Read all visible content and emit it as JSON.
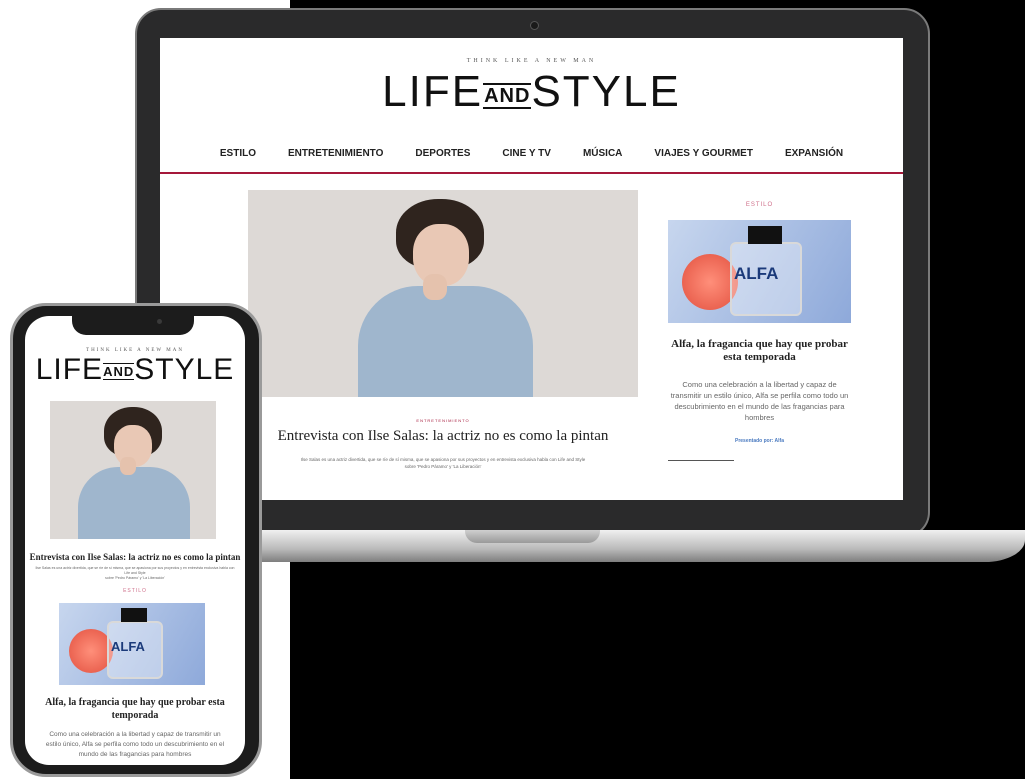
{
  "brand": {
    "tagline": "THINK LIKE A NEW MAN",
    "logo_left": "LIFE",
    "logo_and": "AND",
    "logo_right": "STYLE"
  },
  "nav": [
    "ESTILO",
    "ENTRETENIMIENTO",
    "DEPORTES",
    "CINE Y TV",
    "MÚSICA",
    "VIAJES Y GOURMET",
    "EXPANSIÓN"
  ],
  "main_article": {
    "kicker": "ENTRETENIMIENTO",
    "headline": "Entrevista con Ilse Salas: la actriz no es como la pintan",
    "excerpt_line1": "Ilse Salas es una actriz divertida, que se ríe de sí misma, que se apasiona por sus proyectos y en entrevista exclusiva habla con Life and Style",
    "excerpt_line2": "sobre 'Pedro Páramo' y 'La Liberación'"
  },
  "side_article": {
    "kicker": "ESTILO",
    "image_label": "ALFA",
    "headline": "Alfa, la fragancia que hay que probar esta temporada",
    "excerpt": "Como una celebración a la libertad y capaz de transmitir un estilo único, Alfa se perfila como todo un descubrimiento en el mundo de las fragancias para hombres",
    "sponsor": "Presentado por: Alfa"
  },
  "colors": {
    "accent": "#a5183a",
    "kicker_pink": "#cf6f8a",
    "sponsor_blue": "#4a7ac0"
  }
}
